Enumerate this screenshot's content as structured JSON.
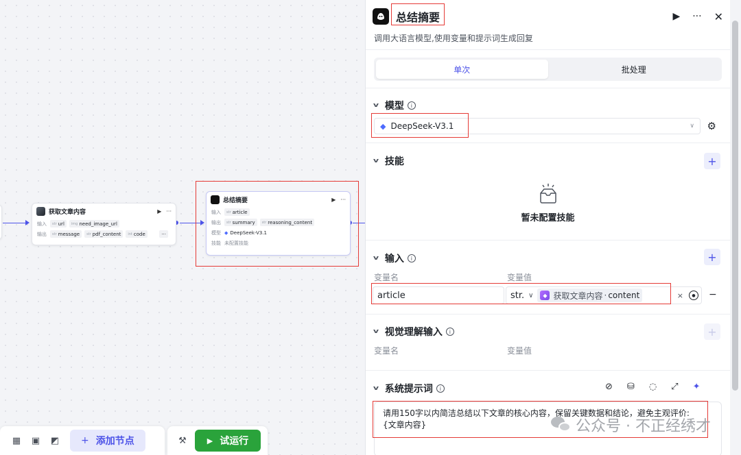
{
  "canvas": {
    "node_fetch": {
      "title": "获取文章内容",
      "input_label": "输入",
      "output_label": "输出",
      "inputs": [
        {
          "type": "str",
          "name": "url"
        },
        {
          "type": "img",
          "name": "need_image_url"
        }
      ],
      "outputs": [
        {
          "type": "str",
          "name": "message"
        },
        {
          "type": "str",
          "name": "pdf_content"
        },
        {
          "type": "int",
          "name": "code"
        }
      ]
    },
    "node_summary": {
      "title": "总结摘要",
      "input_label": "输入",
      "output_label": "输出",
      "model_label": "模型",
      "skill_label": "技能",
      "inputs": [
        {
          "type": "str",
          "name": "article"
        }
      ],
      "outputs": [
        {
          "type": "str",
          "name": "summary"
        },
        {
          "type": "str",
          "name": "reasoning_content"
        }
      ],
      "model": "DeepSeek-V3.1",
      "skill": "未配置技能"
    },
    "toolbar": {
      "add_node": "添加节点",
      "test_run": "试运行"
    }
  },
  "panel": {
    "title": "总结摘要",
    "description": "调用大语言模型,使用变量和提示词生成回复",
    "tabs": [
      "单次",
      "批处理"
    ],
    "active_tab": 0,
    "model_section": {
      "title": "模型",
      "selected": "DeepSeek-V3.1"
    },
    "skill_section": {
      "title": "技能",
      "empty_text": "暂未配置技能"
    },
    "input_section": {
      "title": "输入",
      "col_name": "变量名",
      "col_value": "变量值",
      "row": {
        "name": "article",
        "type": "str.",
        "ref_node": "获取文章内容",
        "ref_sep": "·",
        "ref_var": "content"
      }
    },
    "vision_section": {
      "title": "视觉理解输入",
      "col_name": "变量名",
      "col_value": "变量值"
    },
    "prompt_section": {
      "title": "系统提示词",
      "text_line1": "请用150字以内简洁总结以下文章的核心内容，保留关键数据和结论，避免主观评价:",
      "text_line2": "{文章内容}"
    }
  },
  "watermark": {
    "text": "公众号 · 不正经绣才"
  },
  "colors": {
    "accent": "#4d53e8",
    "run_green": "#2aa33b",
    "highlight_red": "#e53935"
  }
}
